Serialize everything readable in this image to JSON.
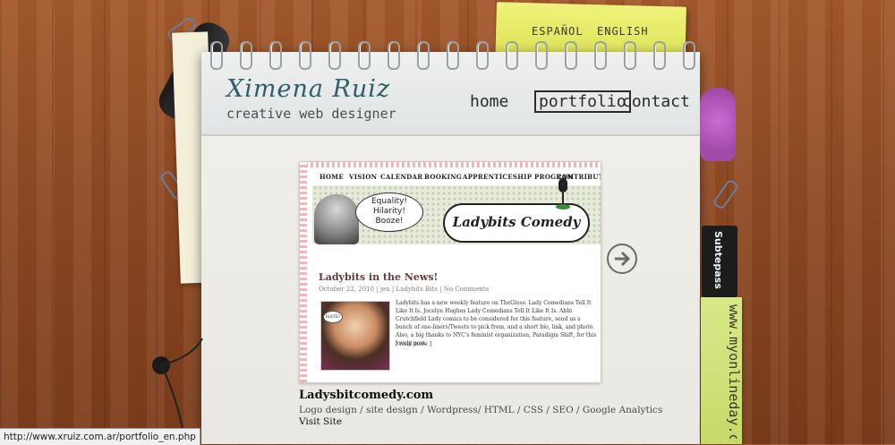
{
  "languages": {
    "es": "ESPAÑOL",
    "en": "ENGLISH"
  },
  "brand": {
    "name": "Ximena Ruiz",
    "tagline": "creative web designer"
  },
  "nav": {
    "home": "home",
    "portfolio": "portfolio",
    "contact": "contact"
  },
  "preview": {
    "nav": [
      "HOME",
      "VISION",
      "CALENDAR",
      "BOOKING",
      "APPRENTICESHIP PROGRAM",
      "CONTRIBUTE"
    ],
    "speech": [
      "Equality!",
      "Hilarity!",
      "Booze!"
    ],
    "logo": "Ladybits Comedy",
    "post_title": "Ladybits in the News!",
    "post_meta": "October 22, 2010 | jen | Ladybits Bits | No Comments",
    "badge": "HATE!",
    "post_body": "Ladybits has a new weekly feature on TheGloss: Lady Comedians Tell It Like It Is. Jocelyn Hughes Lady Comedians Tell It Like It Is. Abbi Crutchfield Lady comics to be considered for this feature, send us a bunch of one-liners/Tweets to pick from, and a short bio, link, and photo. Also, a big thanks to NYC's feminist organization, Paradigm Shift, for this lovely post.",
    "read_more": "[ read more ]"
  },
  "project": {
    "title": "Ladysbitcomedy.com",
    "tags": "Logo design / site design / Wordpress/ HTML / CSS / SEO / Google Analytics",
    "visit": "Visit Site"
  },
  "side": {
    "subtepass": "Subtepass",
    "sticky": "www.myonlineday.com"
  },
  "status_url": "http://www.xruiz.com.ar/portfolio_en.php",
  "colors": {
    "wood": "#8f4a23",
    "note_yellow": "#dde354",
    "brand_teal": "#2c5f66"
  }
}
